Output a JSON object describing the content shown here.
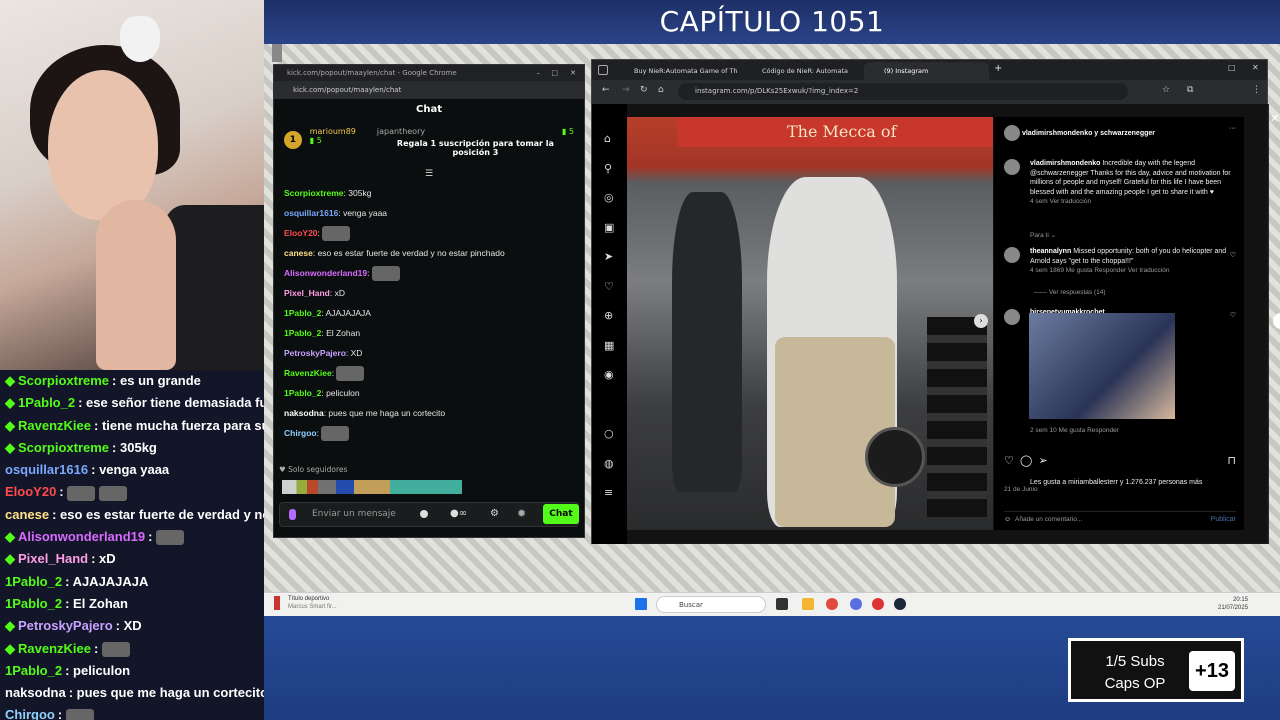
{
  "stream": {
    "title": "CAPÍTULO 1051"
  },
  "sub_goal": {
    "line1": "1/5 Subs",
    "line2": "Caps OP",
    "bonus": "+13"
  },
  "side_chat": [
    {
      "user": "Scorpioxtreme",
      "color": "#53fc18",
      "text": "es un grande",
      "badge": "diamond"
    },
    {
      "user": "1Pablo_2",
      "color": "#53fc18",
      "text": "ese señor tiene demasiada fuerza",
      "badge": "diamond"
    },
    {
      "user": "RavenzKiee",
      "color": "#53fc18",
      "text": "tiene mucha fuerza para su ta",
      "badge": "diamond"
    },
    {
      "user": "Scorpioxtreme",
      "color": "#53fc18",
      "text": "305kg",
      "badge": "diamond"
    },
    {
      "user": "osquillar1616",
      "color": "#7aa7ff",
      "text": "venga yaaa",
      "badge": ""
    },
    {
      "user": "ElooY20",
      "color": "#ff4b4b",
      "text": "",
      "badge": "",
      "emotes": 2
    },
    {
      "user": "canese",
      "color": "#ffe08a",
      "text": "eso es estar fuerte de verdad y no es",
      "badge": ""
    },
    {
      "user": "Alisonwonderland19",
      "color": "#d86bff",
      "text": "",
      "badge": "diamond",
      "emotes": 1
    },
    {
      "user": "Pixel_Hand",
      "color": "#ff9ee6",
      "text": "xD",
      "badge": "diamond"
    },
    {
      "user": "1Pablo_2",
      "color": "#53fc18",
      "text": "AJAJAJAJA",
      "badge": ""
    },
    {
      "user": "1Pablo_2",
      "color": "#53fc18",
      "text": "El Zohan",
      "badge": ""
    },
    {
      "user": "PetroskyPajero",
      "color": "#c8a2ff",
      "text": "XD",
      "badge": "diamond"
    },
    {
      "user": "RavenzKiee",
      "color": "#53fc18",
      "text": "",
      "badge": "diamond",
      "emotes": 1
    },
    {
      "user": "1Pablo_2",
      "color": "#53fc18",
      "text": "peliculon",
      "badge": ""
    },
    {
      "user": "naksodna",
      "color": "#ffffff",
      "text": "pues que me haga un cortecito",
      "badge": ""
    },
    {
      "user": "Chirgoo",
      "color": "#8fd0ff",
      "text": "",
      "badge": "",
      "emotes": 1
    }
  ],
  "kick": {
    "window_title": "kick.com/popout/maaylen/chat - Google Chrome",
    "url": "kick.com/popout/maaylen/chat",
    "chat_title": "Chat",
    "pinned": {
      "rank": "1",
      "user1": "marioum89",
      "count1": "5",
      "user2": "japantheory",
      "count2": "5",
      "text": "Regala 1 suscripción para tomar la posición 3"
    },
    "messages": [
      {
        "user": "Scorpioxtreme",
        "color": "#53fc18",
        "text": "305kg"
      },
      {
        "user": "osquillar1616",
        "color": "#7aa7ff",
        "text": "venga yaaa"
      },
      {
        "user": "ElooY20",
        "color": "#ff4b4b",
        "text": ""
      },
      {
        "user": "canese",
        "color": "#ffe08a",
        "text": "eso es estar fuerte de verdad y no estar pinchado"
      },
      {
        "user": "Alisonwonderland19",
        "color": "#d86bff",
        "text": ""
      },
      {
        "user": "Pixel_Hand",
        "color": "#ff9ee6",
        "text": "xD"
      },
      {
        "user": "1Pablo_2",
        "color": "#53fc18",
        "text": "AJAJAJAJA"
      },
      {
        "user": "1Pablo_2",
        "color": "#53fc18",
        "text": "El Zohan"
      },
      {
        "user": "PetroskyPajero",
        "color": "#c8a2ff",
        "text": "XD"
      },
      {
        "user": "RavenzKiee",
        "color": "#53fc18",
        "text": ""
      },
      {
        "user": "1Pablo_2",
        "color": "#53fc18",
        "text": "peliculon"
      },
      {
        "user": "naksodna",
        "color": "#ffffff",
        "text": "pues que me haga un cortecito"
      },
      {
        "user": "Chirgoo",
        "color": "#8fd0ff",
        "text": ""
      }
    ],
    "followers_only": "Solo seguidores",
    "input_placeholder": "Enviar un mensaje",
    "send_label": "Chat"
  },
  "chrome": {
    "tabs": [
      "Buy NieR:Automata Game of Th",
      "Código de NieR: Automata (Ga",
      "(9) Instagram"
    ],
    "url": "instagram.com/p/DLKs25Exwuk/?img_index=2"
  },
  "instagram": {
    "photo_sign": "The Mecca of",
    "header": "vladimirshmondenko y schwarzenegger",
    "caption_user": "vladimirshmondenko",
    "caption": "Incredible day with the legend @schwarzenegger Thanks for this day, advice and motivation for millions of people and myself! Grateful for this life I have been blessed with and the amazing people I get to share it with ♥",
    "caption_meta": "4 sem   Ver traducción",
    "for_you": "Para ti ⌄",
    "comment1_user": "theannalynn",
    "comment1_text": "Missed opportunity: both of you do helicopter and Arnold says \"get to the choppa!!!\"",
    "comment1_meta": "4 sem   1869 Me gusta   Responder   Ver traducción",
    "replies": "Ver respuestas (14)",
    "comment2_user": "birsepetyumakkrochet",
    "comment2_meta": "2 sem   10 Me gusta   Responder",
    "likes": "Les gusta a miriamballesterr y 1.276.237 personas más",
    "date": "21 de Junio",
    "add_comment": "Añade un comentario...",
    "publish": "Publicar"
  },
  "taskbar": {
    "weather_title": "Título deportivo",
    "weather_sub": "Marcus Smart fir...",
    "search": "Buscar",
    "time": "20:15",
    "date": "21/07/2025"
  }
}
